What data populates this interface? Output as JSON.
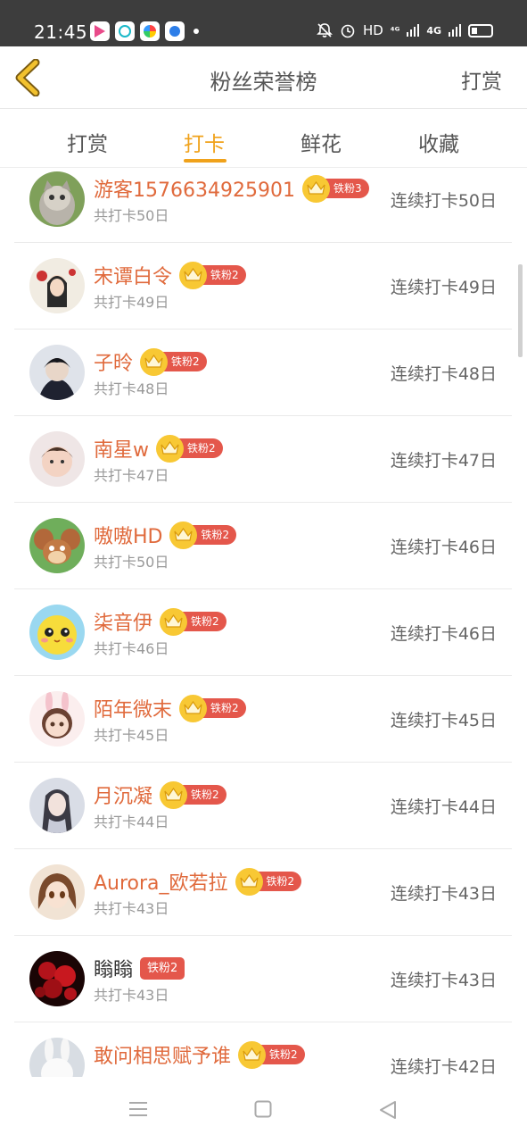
{
  "status_bar": {
    "time": "21:45",
    "icons": [
      "mute-icon",
      "alarm-icon"
    ],
    "hd": "HD",
    "signal1": "⁴ᴳ",
    "signal2": "4G"
  },
  "header": {
    "title": "粉丝荣誉榜",
    "action": "打赏"
  },
  "tabs": [
    {
      "label": "打赏"
    },
    {
      "label": "打卡"
    },
    {
      "label": "鲜花"
    },
    {
      "label": "收藏"
    }
  ],
  "active_tab": "打卡",
  "colors": {
    "accent": "#f0a21b",
    "name": "#e06a3c",
    "badge": "#e4574b",
    "crown": "#f8c834"
  },
  "rows": [
    {
      "name": "游客1576634925901",
      "badge": "铁粉3",
      "total": "共打卡50日",
      "streak": "连续打卡50日"
    },
    {
      "name": "宋谭白令",
      "badge": "铁粉2",
      "total": "共打卡49日",
      "streak": "连续打卡49日"
    },
    {
      "name": "子昤",
      "badge": "铁粉2",
      "total": "共打卡48日",
      "streak": "连续打卡48日"
    },
    {
      "name": "南星w",
      "badge": "铁粉2",
      "total": "共打卡47日",
      "streak": "连续打卡47日"
    },
    {
      "name": "嗷嗷HD",
      "badge": "铁粉2",
      "total": "共打卡50日",
      "streak": "连续打卡46日"
    },
    {
      "name": "柒音伊",
      "badge": "铁粉2",
      "total": "共打卡46日",
      "streak": "连续打卡46日"
    },
    {
      "name": "陌年微末",
      "badge": "铁粉2",
      "total": "共打卡45日",
      "streak": "连续打卡45日"
    },
    {
      "name": "月沉凝",
      "badge": "铁粉2",
      "total": "共打卡44日",
      "streak": "连续打卡44日"
    },
    {
      "name": "Aurora_欧若拉",
      "badge": "铁粉2",
      "total": "共打卡43日",
      "streak": "连续打卡43日"
    },
    {
      "name": "瞈瞈",
      "badge": "铁粉2",
      "total": "共打卡43日",
      "streak": "连续打卡43日"
    },
    {
      "name": "敢问相思赋予谁",
      "badge": "铁粉2",
      "total": "",
      "streak": "连续打卡42日"
    }
  ]
}
